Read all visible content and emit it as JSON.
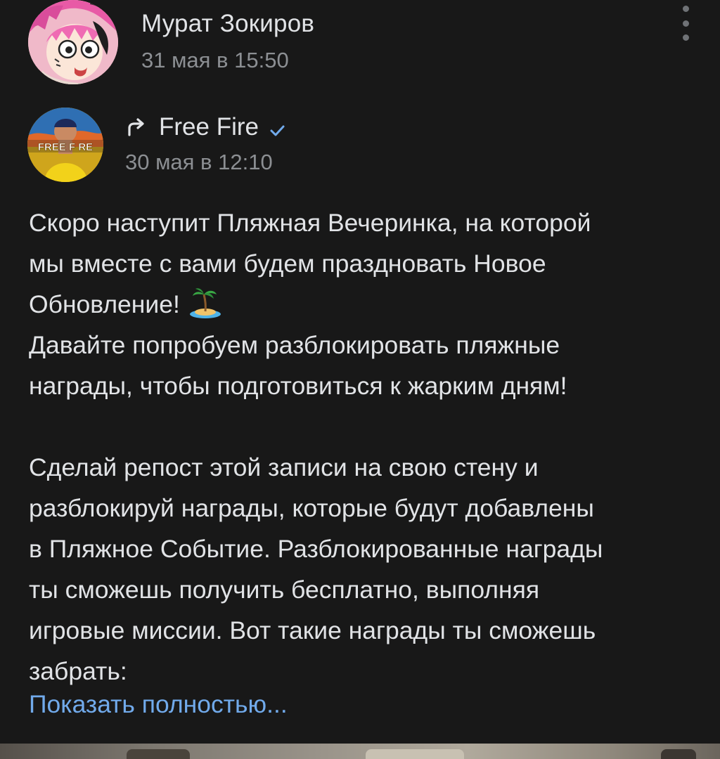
{
  "post": {
    "author": {
      "name": "Мурат Зокиров",
      "date": "31 мая в 15:50",
      "avatar_icon": "anime-character-avatar"
    },
    "menu_icon": "vertical-ellipsis-icon",
    "repost": {
      "repost_icon": "repost-arrow-icon",
      "source_name": "Free Fire",
      "verified_icon": "verified-check-icon",
      "date": "30 мая в 12:10",
      "avatar_icon": "free-fire-logo-avatar",
      "avatar_text": "FREE F RE"
    },
    "text_lines": [
      "Скоро наступит Пляжная Вечеринка, на которой",
      "мы вместе с вами будем праздновать Новое",
      "Обновление!",
      "Давайте попробуем разблокировать пляжные",
      "награды, чтобы подготовиться к жарким дням!",
      "",
      "Сделай репост этой записи на свою стену и",
      "разблокируй награды, которые будут добавлены",
      "в Пляжное Событие. Разблокированные награды",
      "ты сможешь получить бесплатно, выполняя",
      "игровые миссии. Вот такие награды ты сможешь",
      "забрать:"
    ],
    "emoji": "palm-island-emoji",
    "show_more": "Показать полностью...",
    "colors": {
      "background": "#181818",
      "text": "#e1e3e6",
      "secondary": "#8c8f93",
      "link": "#71aaeb"
    }
  }
}
